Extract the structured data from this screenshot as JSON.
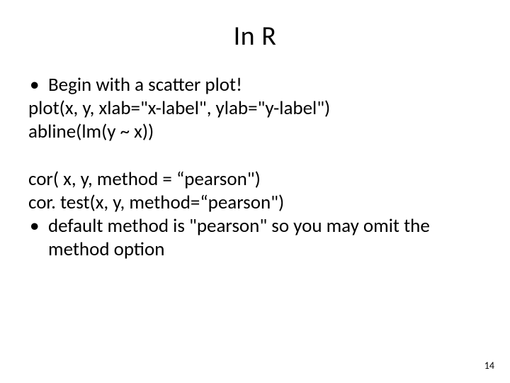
{
  "title": "In R",
  "block1": {
    "bullet": "Begin with a scatter plot!",
    "line1": "plot(x, y, xlab=\"x-label\", ylab=\"y-label\")",
    "line2": "abline(lm(y ~ x))"
  },
  "block2": {
    "line1": "cor( x, y, method = “pearson\")",
    "line2": "cor. test(x, y, method=“pearson\")",
    "bullet": "default method is \"pearson\" so you may omit the method option"
  },
  "page_number": "14",
  "bullet_glyph": "•"
}
